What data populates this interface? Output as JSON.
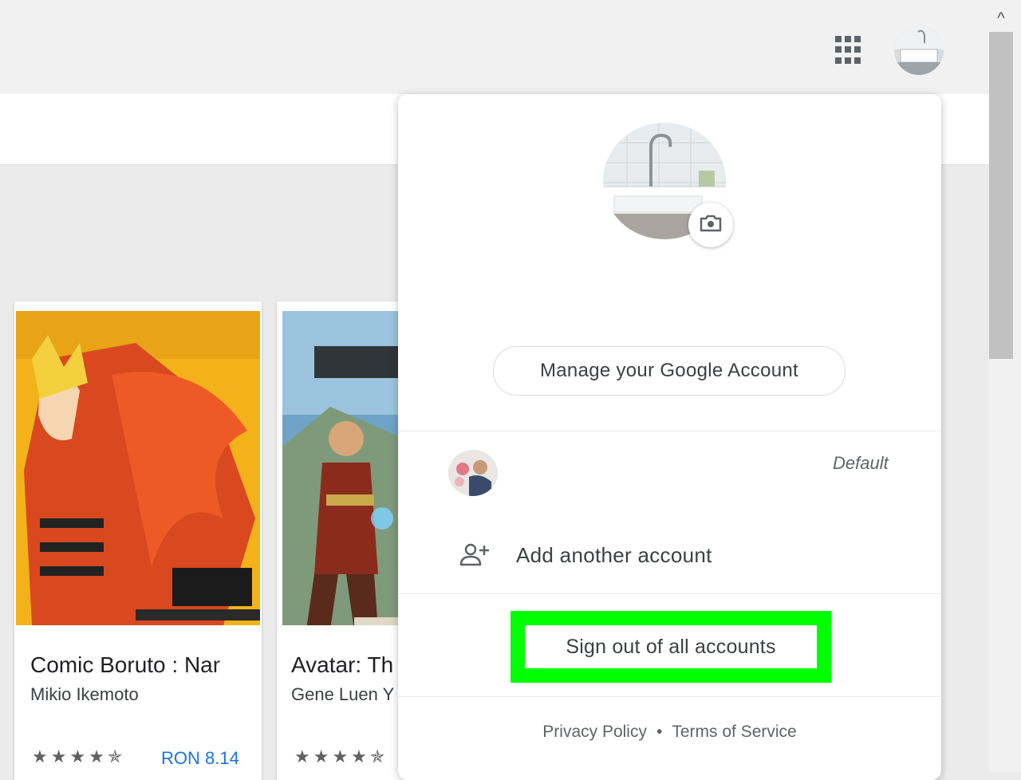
{
  "header": {
    "apps_icon": "apps-grid-icon",
    "account_avatar_icon": "account-avatar-icon"
  },
  "scrollbar": {
    "up_arrow": "^"
  },
  "books": [
    {
      "title": "Comic Boruto : Nar",
      "author": "Mikio Ikemoto",
      "stars": "★★★★✯",
      "price": "RON 8.14",
      "rating": 4.5
    },
    {
      "title": "Avatar: Th",
      "author": "Gene Luen Y",
      "stars": "★★★★✯",
      "rating": 4.5
    }
  ],
  "account_menu": {
    "manage_account": "Manage your Google Account",
    "default_label": "Default",
    "add_account": "Add another account",
    "sign_out": "Sign out of all accounts",
    "privacy_policy": "Privacy Policy",
    "separator": "•",
    "terms_of_service": "Terms of Service",
    "highlight_color": "#00ff00"
  }
}
